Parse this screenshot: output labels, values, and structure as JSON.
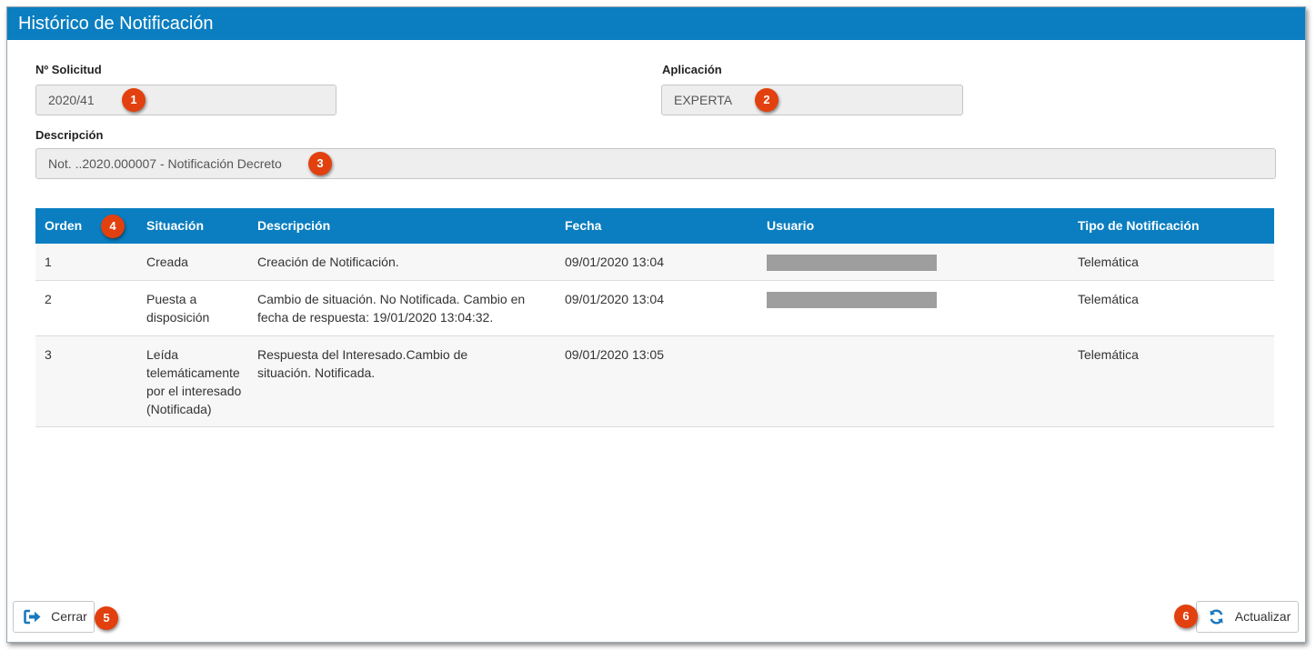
{
  "window": {
    "title": "Histórico de Notificación"
  },
  "form": {
    "solicitud_label": "Nº Solicitud",
    "solicitud_value": "2020/41",
    "aplicacion_label": "Aplicación",
    "aplicacion_value": "EXPERTA",
    "descripcion_label": "Descripción",
    "descripcion_value": "Not. ..2020.000007 - Notificación Decreto"
  },
  "badges": [
    "1",
    "2",
    "3",
    "4",
    "5",
    "6"
  ],
  "table": {
    "headers": [
      "Orden",
      "Situación",
      "Descripción",
      "Fecha",
      "Usuario",
      "Tipo de Notificación"
    ],
    "rows": [
      {
        "orden": "1",
        "situacion": "Creada",
        "descripcion": "Creación de Notificación.",
        "fecha": "09/01/2020 13:04",
        "usuario_redacted": true,
        "tipo": "Telemática"
      },
      {
        "orden": "2",
        "situacion": "Puesta a disposición",
        "descripcion": "Cambio de situación. No Notificada. Cambio en fecha de respuesta: 19/01/2020 13:04:32.",
        "fecha": "09/01/2020 13:04",
        "usuario_redacted": true,
        "tipo": "Telemática"
      },
      {
        "orden": "3",
        "situacion": "Leída telemáticamente por el interesado (Notificada)",
        "descripcion": "Respuesta del Interesado.Cambio de situación. Notificada.",
        "fecha": "09/01/2020 13:05",
        "usuario_redacted": false,
        "tipo": "Telemática"
      }
    ]
  },
  "buttons": {
    "close_label": "Cerrar",
    "close_icon": "sign-out-icon",
    "refresh_label": "Actualizar",
    "refresh_icon": "refresh-icon"
  },
  "colors": {
    "header_blue": "#0a7ec0",
    "badge_red": "#e2400e"
  }
}
